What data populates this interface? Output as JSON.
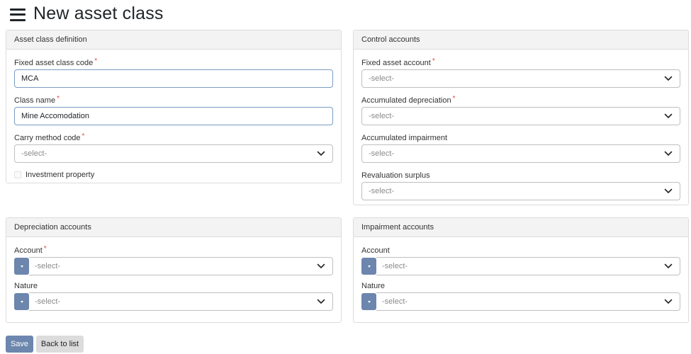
{
  "page": {
    "title": "New asset class",
    "menu_icon": "hamburger-menu-icon"
  },
  "definition": {
    "header": "Asset class definition",
    "code_label": "Fixed asset class code",
    "code_value": "MCA",
    "name_label": "Class name",
    "name_value": "Mine Accomodation",
    "carry_label": "Carry method code",
    "carry_value": "-select-",
    "investment_label": "Investment property",
    "investment_checked": false
  },
  "control": {
    "header": "Control accounts",
    "fixed_asset_label": "Fixed asset account",
    "fixed_asset_value": "-select-",
    "accum_depr_label": "Accumulated depreciation",
    "accum_depr_value": "-select-",
    "accum_imp_label": "Accumulated impairment",
    "accum_imp_value": "-select-",
    "reval_label": "Revaluation surplus",
    "reval_value": "-select-"
  },
  "depreciation": {
    "header": "Depreciation accounts",
    "account_label": "Account",
    "account_value": "-select-",
    "nature_label": "Nature",
    "nature_value": "-select-"
  },
  "impairment": {
    "header": "Impairment accounts",
    "account_label": "Account",
    "account_value": "-select-",
    "nature_label": "Nature",
    "nature_value": "-select-"
  },
  "required_marker": "*",
  "actions": {
    "save_label": "Save",
    "back_label": "Back to list"
  },
  "colors": {
    "primary": "#6c86ad",
    "secondary": "#dcdcdc",
    "required": "#e04a4a",
    "input_focus_border": "#7a9cc4"
  }
}
